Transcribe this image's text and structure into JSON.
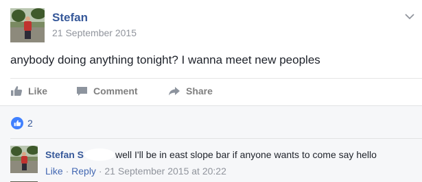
{
  "post": {
    "author": "Stefan",
    "timestamp": "21 September 2015",
    "text": "anybody doing anything tonight? I wanna meet new peoples",
    "menu_icon": "chevron-down-icon"
  },
  "actions": {
    "like_label": "Like",
    "comment_label": "Comment",
    "share_label": "Share"
  },
  "reactions": {
    "count": "2",
    "icon": "thumbs-up-icon"
  },
  "comment": {
    "author": "Stefan S",
    "text": "well I'll be in east slope bar if anyone wants to come say hello",
    "like_link": "Like",
    "reply_link": "Reply",
    "separator": "·",
    "timestamp": "21 September 2015 at 20:22"
  },
  "colors": {
    "link_blue": "#365899",
    "meta_gray": "#90949c",
    "like_badge": "#4080ff",
    "comments_bg": "#f6f7f9"
  }
}
